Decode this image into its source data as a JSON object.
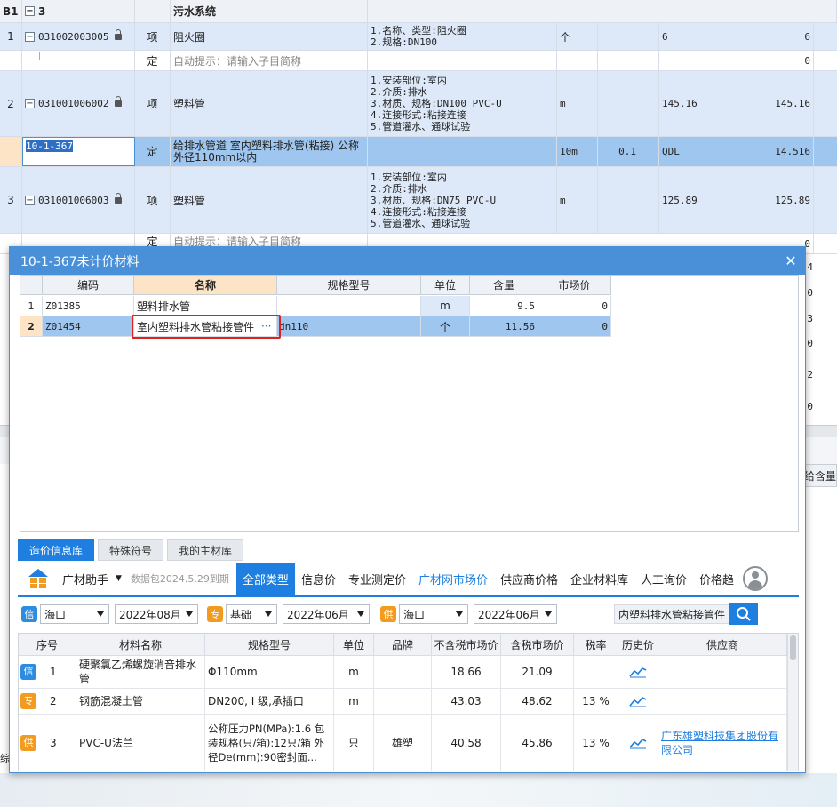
{
  "background_table": {
    "group_row": {
      "num": "B1",
      "code": "3",
      "name": "污水系统"
    },
    "rows": [
      {
        "num": "1",
        "code": "031002003005",
        "type": "项",
        "name": "阻火圈",
        "features": [
          "1.名称、类型:阻火圈",
          "2.规格:DN100"
        ],
        "unit": "个",
        "qty": "",
        "expr": "6",
        "amount": "6"
      },
      {
        "num": "",
        "code": "",
        "type": "定",
        "name": "自动提示：请输入子目简称",
        "features": [],
        "unit": "",
        "qty": "",
        "expr": "",
        "amount": "0"
      },
      {
        "num": "2",
        "code": "031001006002",
        "type": "项",
        "name": "塑料管",
        "features": [
          "1.安装部位:室内",
          "2.介质:排水",
          "3.材质、规格:DN100 PVC-U",
          "4.连接形式:粘接连接",
          "5.管道灌水、通球试验"
        ],
        "unit": "m",
        "qty": "",
        "expr": "145.16",
        "amount": "145.16"
      },
      {
        "num": "",
        "code": "10-1-367",
        "type": "定",
        "name": "给排水管道 室内塑料排水管(粘接) 公称外径110mm以内",
        "features": [],
        "unit": "10m",
        "qty": "0.1",
        "expr": "QDL",
        "amount": "14.516"
      },
      {
        "num": "3",
        "code": "031001006003",
        "type": "项",
        "name": "塑料管",
        "features": [
          "1.安装部位:室内",
          "2.介质:排水",
          "3.材质、规格:DN75 PVC-U",
          "4.连接形式:粘接连接",
          "5.管道灌水、通球试验"
        ],
        "unit": "m",
        "qty": "",
        "expr": "125.89",
        "amount": "125.89"
      },
      {
        "num": "",
        "code": "",
        "type": "定",
        "name": "自动提示：请输入子目简称",
        "features": [],
        "unit": "",
        "qty": "",
        "expr": "",
        "amount": "0"
      }
    ],
    "side_values": [
      "4",
      "0",
      "3",
      "0",
      "2",
      "0"
    ],
    "right_label": "给含量",
    "left_bottom": "综合"
  },
  "dialog": {
    "title": "10-1-367未计价材料",
    "close": "✕",
    "columns": [
      "编码",
      "名称",
      "规格型号",
      "单位",
      "含量",
      "市场价"
    ],
    "rows": [
      {
        "num": "1",
        "code": "Z01385",
        "name": "塑料排水管",
        "spec": "",
        "unit": "m",
        "qty": "9.5",
        "price": "0"
      },
      {
        "num": "2",
        "code": "Z01454",
        "name": "室内塑料排水管粘接管件",
        "spec": "dn110",
        "unit": "个",
        "qty": "11.56",
        "price": "0"
      }
    ],
    "ellipsis": "···"
  },
  "tabs": [
    "造价信息库",
    "特殊符号",
    "我的主材库"
  ],
  "toolbar": {
    "brand": "广材助手",
    "data_pack": "数据包2024.5.29到期",
    "items": [
      "全部类型",
      "信息价",
      "专业测定价",
      "广材网市场价",
      "供应商价格",
      "企业材料库",
      "人工询价",
      "价格趋"
    ]
  },
  "filters": {
    "xin_badge": "信",
    "zhuan_badge": "专",
    "gong_badge": "供",
    "region1": "海口",
    "date1": "2022年08月",
    "type2": "基础",
    "date2": "2022年06月",
    "region3": "海口",
    "date3": "2022年06月",
    "search_value": "内塑料排水管粘接管件"
  },
  "results": {
    "columns": [
      "序号",
      "材料名称",
      "规格型号",
      "单位",
      "品牌",
      "不含税市场价",
      "含税市场价",
      "税率",
      "历史价",
      "供应商"
    ],
    "rows": [
      {
        "badge": "信",
        "num": "1",
        "name": "硬聚氯乙烯螺旋消音排水管",
        "spec": "Φ110mm",
        "unit": "m",
        "brand": "",
        "price_ex": "18.66",
        "price_in": "21.09",
        "tax": "",
        "supplier": ""
      },
      {
        "badge": "专",
        "num": "2",
        "name": "钢筋混凝土管",
        "spec": "DN200, I 级,承插口",
        "unit": "m",
        "brand": "",
        "price_ex": "43.03",
        "price_in": "48.62",
        "tax": "13 %",
        "supplier": ""
      },
      {
        "badge": "供",
        "num": "3",
        "name": "PVC-U法兰",
        "spec": "公称压力PN(MPa):1.6 包装规格(只/箱):12只/箱 外径De(mm):90密封面...",
        "unit": "只",
        "brand": "雄塑",
        "price_ex": "40.58",
        "price_in": "45.86",
        "tax": "13 %",
        "supplier": "广东雄塑科技集团股份有限公司"
      }
    ]
  },
  "colors": {
    "accent": "#1e7fe0",
    "title_bar": "#4a90d9",
    "highlight_red": "#e0201c"
  }
}
